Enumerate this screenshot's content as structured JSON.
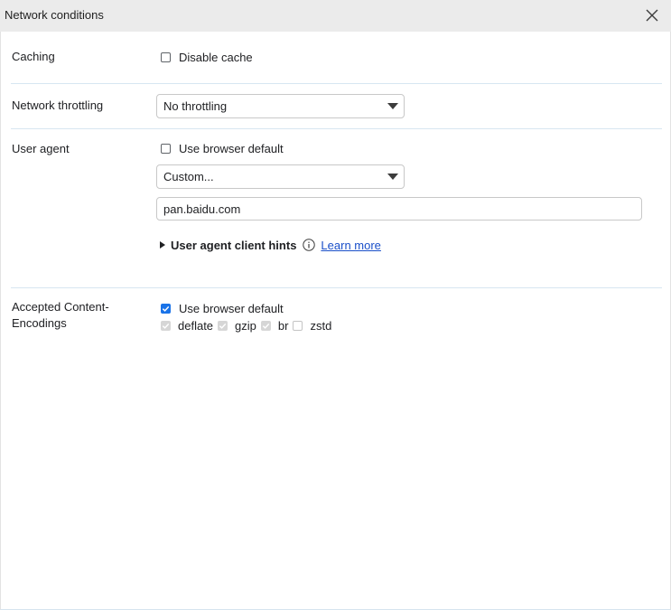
{
  "window": {
    "title": "Network conditions",
    "close_icon": "close-icon"
  },
  "caching": {
    "label": "Caching",
    "disable_cache_label": "Disable cache",
    "disable_cache_checked": false
  },
  "throttling": {
    "label": "Network throttling",
    "selected": "No throttling"
  },
  "user_agent": {
    "label": "User agent",
    "use_default_label": "Use browser default",
    "use_default_checked": false,
    "selected": "Custom...",
    "value": "pan.baidu.com",
    "hints_label": "User agent client hints",
    "learn_more": "Learn more"
  },
  "encodings": {
    "label": "Accepted Content-Encodings",
    "use_default_label": "Use browser default",
    "use_default_checked": true,
    "options": [
      {
        "label": "deflate",
        "checked": true
      },
      {
        "label": "gzip",
        "checked": true
      },
      {
        "label": "br",
        "checked": true
      },
      {
        "label": "zstd",
        "checked": false
      }
    ]
  },
  "colors": {
    "accent": "#1a73e8",
    "link": "#1a4fc9",
    "titlebar": "#ebebeb",
    "divider": "#d7e6f1"
  }
}
